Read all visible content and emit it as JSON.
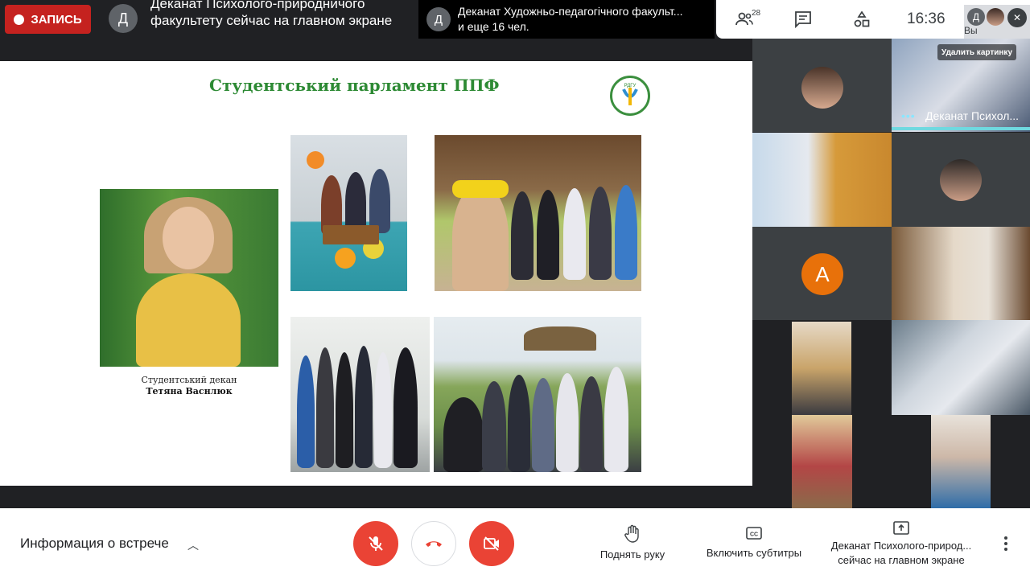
{
  "recording": {
    "label": "ЗАПИСЬ"
  },
  "presenter": {
    "avatar_letter": "Д",
    "text": "Деканат Психолого-природничого факультету сейчас на главном экране"
  },
  "notification": {
    "avatar_letter": "Д",
    "line1": "Деканат Художньо-педагогічного факульт...",
    "line2": "и еще 16 чел."
  },
  "top_right": {
    "participants_count": "28",
    "clock": "16:36",
    "self_avatar_letter": "Д",
    "self_label": "Вы"
  },
  "slide": {
    "title": "Студентський парламент ППФ",
    "logo_text": "РДГУ",
    "caption_role": "Студентський декан",
    "caption_name": "Тетяна Васнлюк"
  },
  "grid": {
    "remove_picture_label": "Удалить картинку",
    "speaking_name": "Деканат Психол...",
    "avatar_letter": "А",
    "avatar_color": "#e8710a"
  },
  "bottom_bar": {
    "meeting_info": "Информация о встрече",
    "raise_hand": "Поднять руку",
    "captions": "Включить субтитры",
    "presenting_line1": "Деканат Психолого-природ...",
    "presenting_line2": "сейчас на главном экране"
  },
  "colors": {
    "danger": "#ea4335",
    "record": "#c5221f",
    "slide_title": "#2d8a34",
    "speaking": "#6fd9e0"
  }
}
